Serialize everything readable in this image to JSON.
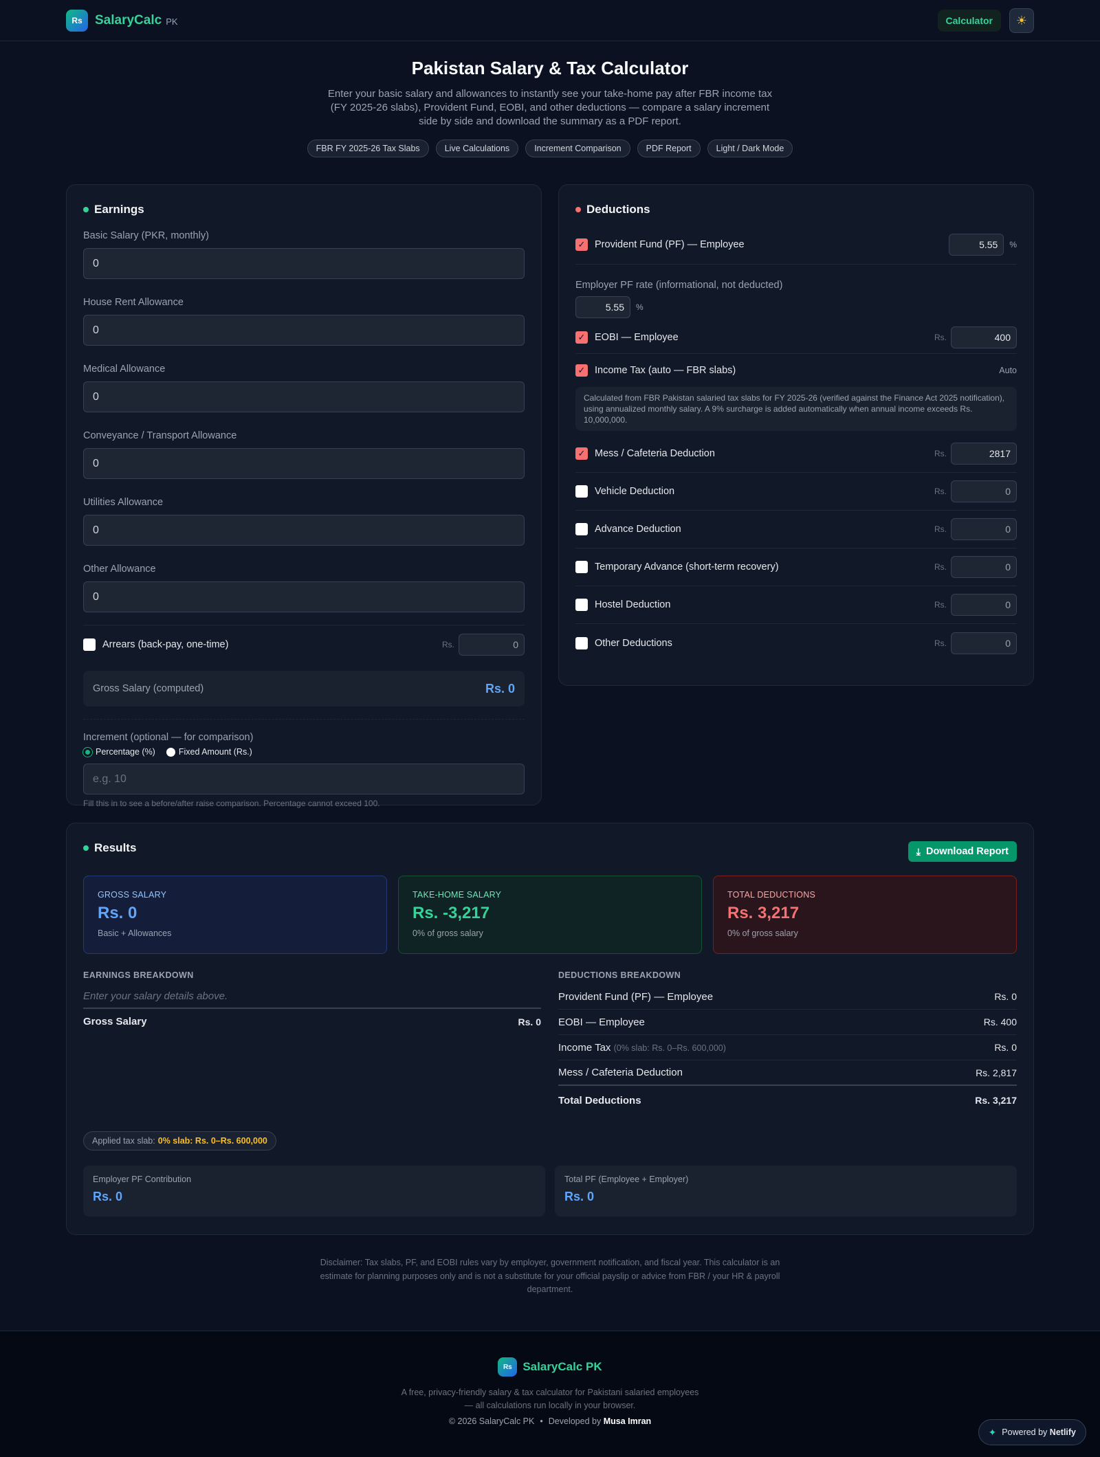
{
  "header": {
    "logo_text": "Rs",
    "brand": "SalaryCalc",
    "brand_suffix": "PK",
    "nav_calculator": "Calculator",
    "theme_icon": "sun-icon"
  },
  "hero": {
    "title": "Pakistan Salary & Tax Calculator",
    "description": "Enter your basic salary and allowances to instantly see your take-home pay after FBR income tax (FY 2025-26 slabs), Provident Fund, EOBI, and other deductions — compare a salary increment side by side and download the summary as a PDF report.",
    "chips": [
      "FBR FY 2025-26 Tax Slabs",
      "Live Calculations",
      "Increment Comparison",
      "PDF Report",
      "Light / Dark Mode"
    ]
  },
  "earnings": {
    "title": "Earnings",
    "fields": [
      {
        "label": "Basic Salary (PKR, monthly)",
        "value": "0"
      },
      {
        "label": "House Rent Allowance",
        "value": "0"
      },
      {
        "label": "Medical Allowance",
        "value": "0"
      },
      {
        "label": "Conveyance / Transport Allowance",
        "value": "0"
      },
      {
        "label": "Utilities Allowance",
        "value": "0"
      },
      {
        "label": "Other Allowance",
        "value": "0"
      }
    ],
    "arrears_label": "Arrears (back-pay, one-time)",
    "arrears_currency": "Rs.",
    "arrears_value": "0",
    "gross_label": "Gross Salary (computed)",
    "gross_value": "Rs. 0",
    "increment_label": "Increment (optional — for comparison)",
    "increment_options": [
      "Percentage (%)",
      "Fixed Amount (Rs.)"
    ],
    "increment_placeholder": "e.g. 10",
    "increment_help": "Fill this in to see a before/after raise comparison. Percentage cannot exceed 100."
  },
  "deductions": {
    "title": "Deductions",
    "pf_label": "Provident Fund (PF) — Employee",
    "pf_value": "5.55",
    "pf_unit": "%",
    "employer_pf_label": "Employer PF rate (informational, not deducted)",
    "employer_pf_value": "5.55",
    "employer_pf_unit": "%",
    "eobi_label": "EOBI — Employee",
    "eobi_value": "400",
    "income_tax_label": "Income Tax (auto — FBR slabs)",
    "income_tax_auto": "Auto",
    "income_tax_note": "Calculated from FBR Pakistan salaried tax slabs for FY 2025-26 (verified against the Finance Act 2025 notification), using annualized monthly salary. A 9% surcharge is added automatically when annual income exceeds Rs. 10,000,000.",
    "currency": "Rs.",
    "items": [
      {
        "label": "Mess / Cafeteria Deduction",
        "value": "2817",
        "checked": true
      },
      {
        "label": "Vehicle Deduction",
        "value": "0",
        "checked": false
      },
      {
        "label": "Advance Deduction",
        "value": "0",
        "checked": false
      },
      {
        "label": "Temporary Advance (short-term recovery)",
        "value": "0",
        "checked": false
      },
      {
        "label": "Hostel Deduction",
        "value": "0",
        "checked": false
      },
      {
        "label": "Other Deductions",
        "value": "0",
        "checked": false
      }
    ]
  },
  "results": {
    "title": "Results",
    "download_label": "Download Report",
    "gross": {
      "label": "Gross Salary",
      "value": "Rs. 0",
      "sub": "Basic + Allowances"
    },
    "takehome": {
      "label": "Take-Home Salary",
      "value": "Rs. -3,217",
      "sub": "0% of gross salary"
    },
    "total_deductions": {
      "label": "Total Deductions",
      "value": "Rs. 3,217",
      "sub": "0% of gross salary"
    },
    "earnings_breakdown_title": "EARNINGS BREAKDOWN",
    "earnings_empty": "Enter your salary details above.",
    "earnings_total_label": "Gross Salary",
    "earnings_total_value": "Rs. 0",
    "deductions_breakdown_title": "DEDUCTIONS BREAKDOWN",
    "deduction_rows": [
      {
        "label": "Provident Fund (PF) — Employee",
        "note": "",
        "value": "Rs. 0"
      },
      {
        "label": "EOBI — Employee",
        "note": "",
        "value": "Rs. 400"
      },
      {
        "label": "Income Tax",
        "note": "(0% slab: Rs. 0–Rs. 600,000)",
        "value": "Rs. 0"
      },
      {
        "label": "Mess / Cafeteria Deduction",
        "note": "",
        "value": "Rs. 2,817"
      }
    ],
    "deductions_total_label": "Total Deductions",
    "deductions_total_value": "Rs. 3,217",
    "slab_prefix": "Applied tax slab:",
    "slab_value": "0% slab: Rs. 0–Rs. 600,000",
    "employer_pf_label": "Employer PF Contribution",
    "employer_pf_value": "Rs. 0",
    "total_pf_label": "Total PF (Employee + Employer)",
    "total_pf_value": "Rs. 0"
  },
  "disclaimer": "Disclaimer: Tax slabs, PF, and EOBI rules vary by employer, government notification, and fiscal year. This calculator is an estimate for planning purposes only and is not a substitute for your official payslip or advice from FBR / your HR & payroll department.",
  "footer": {
    "brand": "SalaryCalc PK",
    "tagline_1": "A free, privacy-friendly salary & tax calculator for Pakistani salaried employees",
    "tagline_2": "— all calculations run locally in your browser.",
    "copyright": "© 2026 SalaryCalc PK",
    "separator": "•",
    "developed_by": "Developed by",
    "developer": "Musa Imran",
    "powered_by": "Powered by",
    "powered_brand": "Netlify"
  },
  "colors": {
    "accent_green": "#10b981",
    "accent_blue": "#60a5fa",
    "accent_red": "#f87171",
    "background": "#0b1120"
  }
}
